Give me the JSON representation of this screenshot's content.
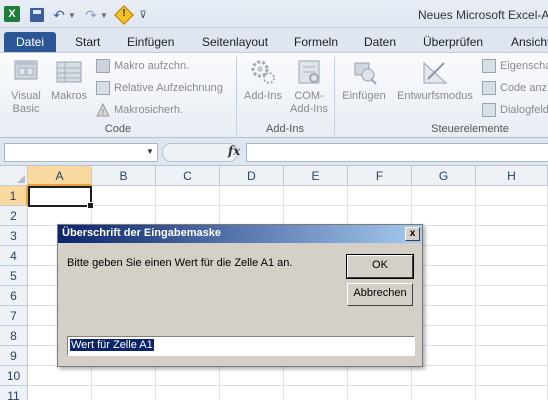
{
  "window": {
    "title": "Neues Microsoft Excel-Arb"
  },
  "qat": {
    "icons": [
      "excel-app-icon",
      "save-icon",
      "undo-icon",
      "redo-icon",
      "warning-icon",
      "customize-icon"
    ]
  },
  "ribbon_tabs": [
    {
      "label": "Datei"
    },
    {
      "label": "Start"
    },
    {
      "label": "Einfügen"
    },
    {
      "label": "Seitenlayout"
    },
    {
      "label": "Formeln"
    },
    {
      "label": "Daten"
    },
    {
      "label": "Überprüfen"
    },
    {
      "label": "Ansicht"
    }
  ],
  "ribbon": {
    "code": {
      "visual_basic": "Visual\nBasic",
      "makros": "Makros",
      "makro_aufzeichnen": "Makro aufzchn.",
      "relative_aufzeichnung": "Relative Aufzeichnung",
      "makrosicherheit": "Makrosicherh.",
      "label": "Code"
    },
    "addins": {
      "addins": "Add-Ins",
      "com_addins": "COM-\nAdd-Ins",
      "label": "Add-Ins"
    },
    "controls": {
      "einfuegen": "Einfügen",
      "entwurfsmodus": "Entwurfsmodus",
      "eigenschaften": "Eigenscha",
      "code_anzeigen": "Code anz",
      "dialogfeld": "Dialogfeld",
      "label": "Steuerelemente"
    }
  },
  "formula_bar": {
    "fx_label": "fx",
    "formula": ""
  },
  "grid": {
    "columns": [
      "A",
      "B",
      "C",
      "D",
      "E",
      "F",
      "G",
      "H"
    ],
    "rows": [
      "1",
      "2",
      "3",
      "4",
      "5",
      "6",
      "7",
      "8",
      "9",
      "10",
      "11"
    ],
    "selected_cell": "A1"
  },
  "dialog": {
    "title": "Überschrift der Eingabemaske",
    "close_label": "x",
    "prompt": "Bitte geben Sie einen Wert für die Zelle A1 an.",
    "ok_label": "OK",
    "cancel_label": "Abbrechen",
    "input_value": "Wert für Zelle A1"
  },
  "colors": {
    "file_tab": "#2b5797",
    "dialog_title_start": "#0a246a",
    "selection_header": "#f9d99e"
  }
}
